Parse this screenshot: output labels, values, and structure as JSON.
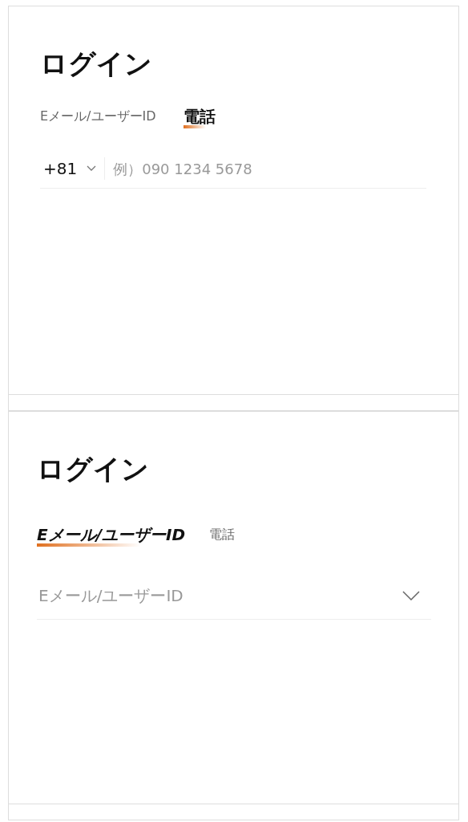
{
  "panels": [
    {
      "title": "ログイン",
      "tabs": [
        {
          "label": "Eメール/ユーザーID",
          "selected": false
        },
        {
          "label": "電話",
          "selected": true
        }
      ],
      "field": {
        "kind": "phone",
        "country_code": "+81",
        "placeholder": "例）090 1234 5678"
      }
    },
    {
      "title": "ログイン",
      "tabs": [
        {
          "label": "Eメール/ユーザーID",
          "selected": true
        },
        {
          "label": "電話",
          "selected": false
        }
      ],
      "field": {
        "kind": "account",
        "placeholder": "Eメール/ユーザーID"
      }
    }
  ]
}
